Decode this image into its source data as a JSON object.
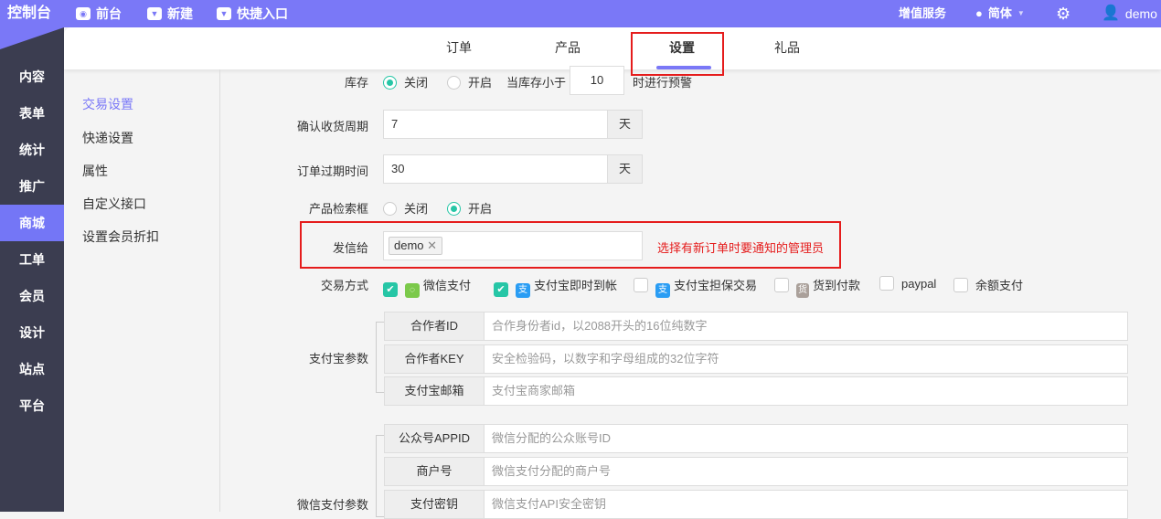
{
  "topbar": {
    "logo": "控制台",
    "front": "前台",
    "new": "新建",
    "quick": "快捷入口",
    "value_service": "增值服务",
    "lang": "简体",
    "user": "demo"
  },
  "sidebar": {
    "items": [
      "内容",
      "表单",
      "统计",
      "推广",
      "商城",
      "工单",
      "会员",
      "设计",
      "站点",
      "平台"
    ],
    "active": "商城"
  },
  "tabs": [
    "订单",
    "产品",
    "设置",
    "礼品"
  ],
  "subnav": [
    "交易设置",
    "快递设置",
    "属性",
    "自定义接口",
    "设置会员折扣"
  ],
  "form": {
    "stock": {
      "label": "库存",
      "off": "关闭",
      "on": "开启",
      "less_than": "当库存小于",
      "threshold": "10",
      "warn": "时进行预警"
    },
    "confirm": {
      "label": "确认收货周期",
      "value": "7",
      "unit": "天"
    },
    "expire": {
      "label": "订单过期时间",
      "value": "30",
      "unit": "天"
    },
    "search_box": {
      "label": "产品检索框",
      "off": "关闭",
      "on": "开启"
    },
    "send_to": {
      "label": "发信给",
      "tag": "demo",
      "hint": "选择有新订单时要通知的管理员"
    },
    "pay": {
      "label": "交易方式",
      "methods": [
        {
          "name": "微信支付",
          "checked": true
        },
        {
          "name": "支付宝即时到帐",
          "checked": true
        },
        {
          "name": "支付宝担保交易",
          "checked": false
        },
        {
          "name": "货到付款",
          "checked": false
        },
        {
          "name": "paypal",
          "checked": false
        },
        {
          "name": "余额支付",
          "checked": false
        }
      ]
    },
    "alipay": {
      "label": "支付宝参数",
      "rows": [
        {
          "key": "合作者ID",
          "placeholder": "合作身份者id，以2088开头的16位纯数字"
        },
        {
          "key": "合作者KEY",
          "placeholder": "安全检验码，以数字和字母组成的32位字符"
        },
        {
          "key": "支付宝邮箱",
          "placeholder": "支付宝商家邮箱"
        }
      ]
    },
    "wechat": {
      "label": "微信支付参数",
      "rows": [
        {
          "key": "公众号APPID",
          "placeholder": "微信分配的公众账号ID"
        },
        {
          "key": "商户号",
          "placeholder": "微信支付分配的商户号"
        },
        {
          "key": "支付密钥",
          "placeholder": "微信支付API安全密钥"
        }
      ]
    }
  }
}
